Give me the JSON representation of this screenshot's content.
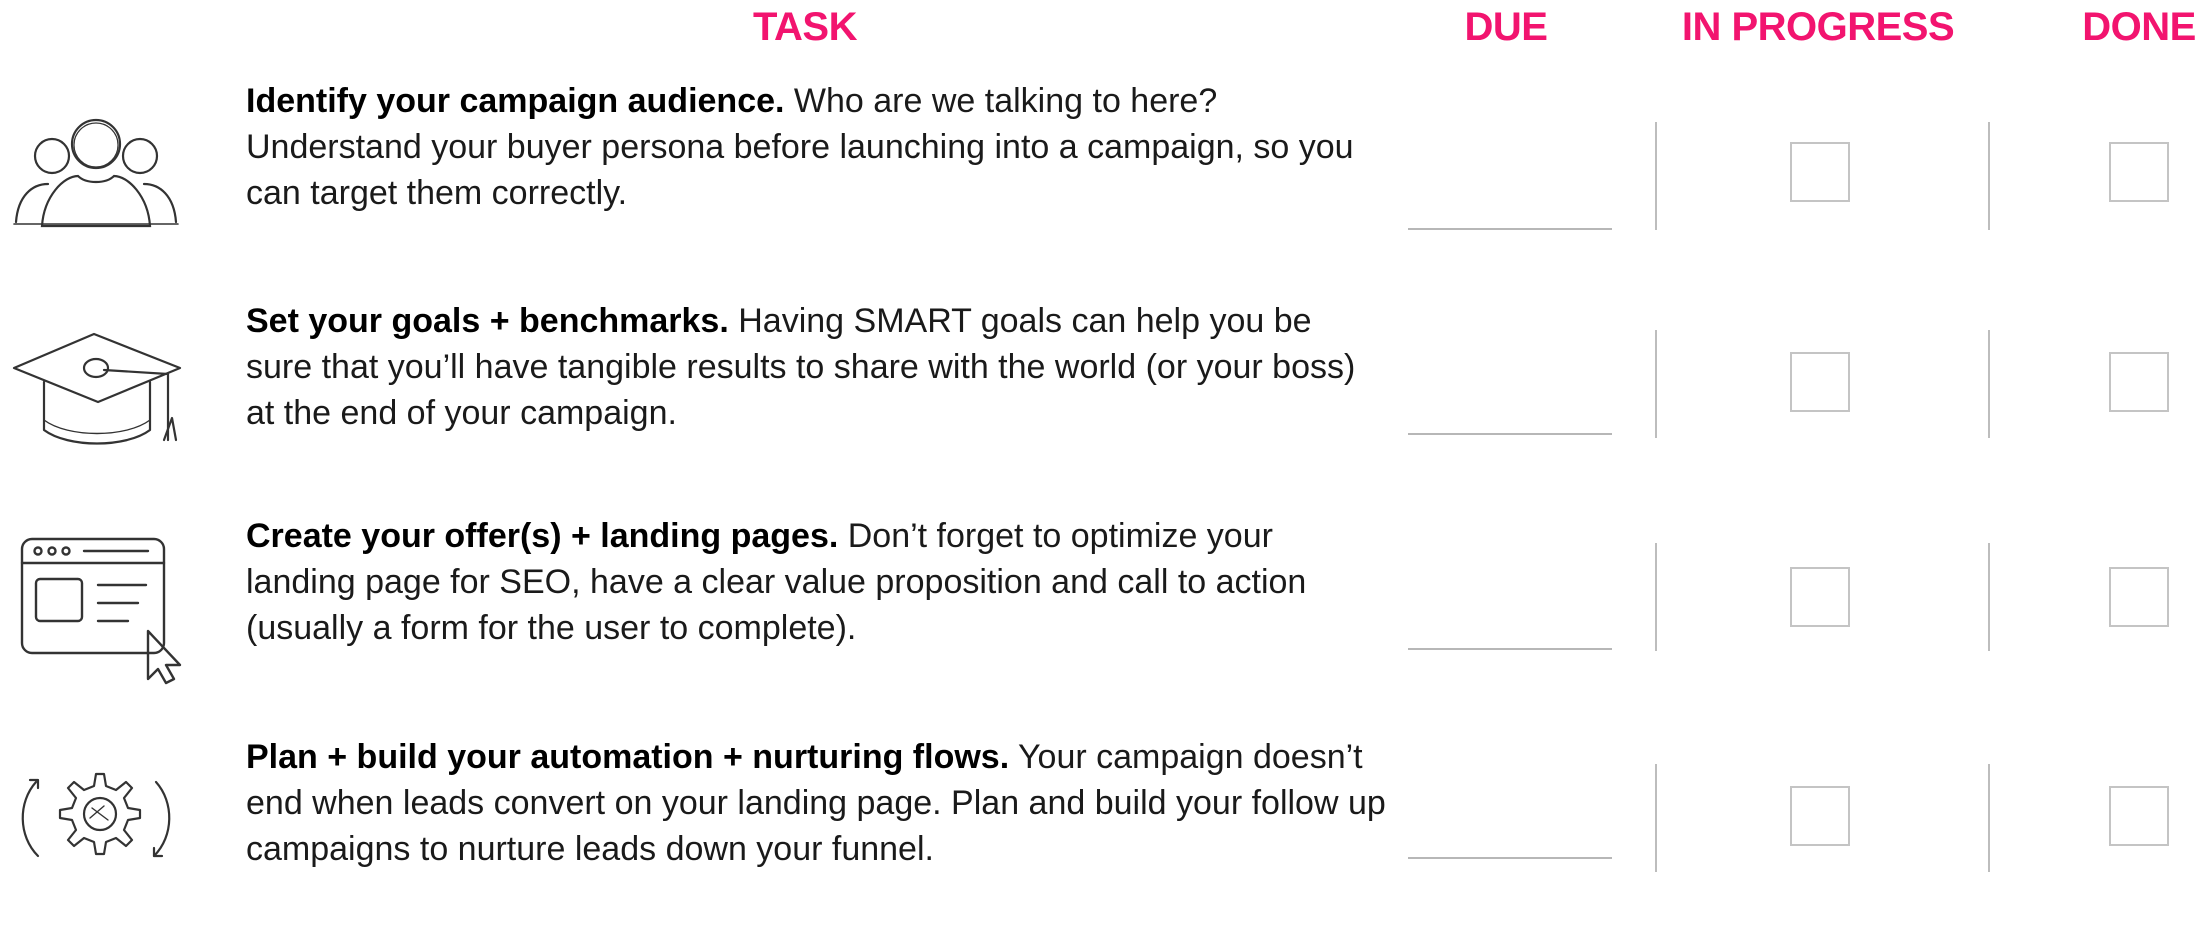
{
  "headers": {
    "task": "TASK",
    "due": "DUE",
    "in_progress": "IN PROGRESS",
    "done": "DONE"
  },
  "accent_color": "#f2146f",
  "tasks": [
    {
      "icon": "audience-people-icon",
      "title": "Identify your campaign audience.",
      "description": " Who are we talking to here? Understand your buyer persona before launching into a campaign, so you can target them correctly.",
      "due": "",
      "in_progress": false,
      "done": false
    },
    {
      "icon": "graduation-cap-icon",
      "title": "Set your goals + benchmarks.",
      "description": " Having SMART goals can help you be sure that you’ll have tangible results to share with the world (or your boss) at the end of your campaign.",
      "due": "",
      "in_progress": false,
      "done": false
    },
    {
      "icon": "browser-landing-page-icon",
      "title": "Create your offer(s) + landing pages.",
      "description": " Don’t forget to optimize your landing page for SEO, have a clear value proposition and call to action (usually a form for the user to complete).",
      "due": "",
      "in_progress": false,
      "done": false
    },
    {
      "icon": "automation-gear-icon",
      "title": "Plan + build your automation + nurturing flows.",
      "description": " Your campaign doesn’t end when leads convert on your landing page. Plan and build your follow up campaigns to nurture leads down your funnel.",
      "due": "",
      "in_progress": false,
      "done": false
    }
  ]
}
